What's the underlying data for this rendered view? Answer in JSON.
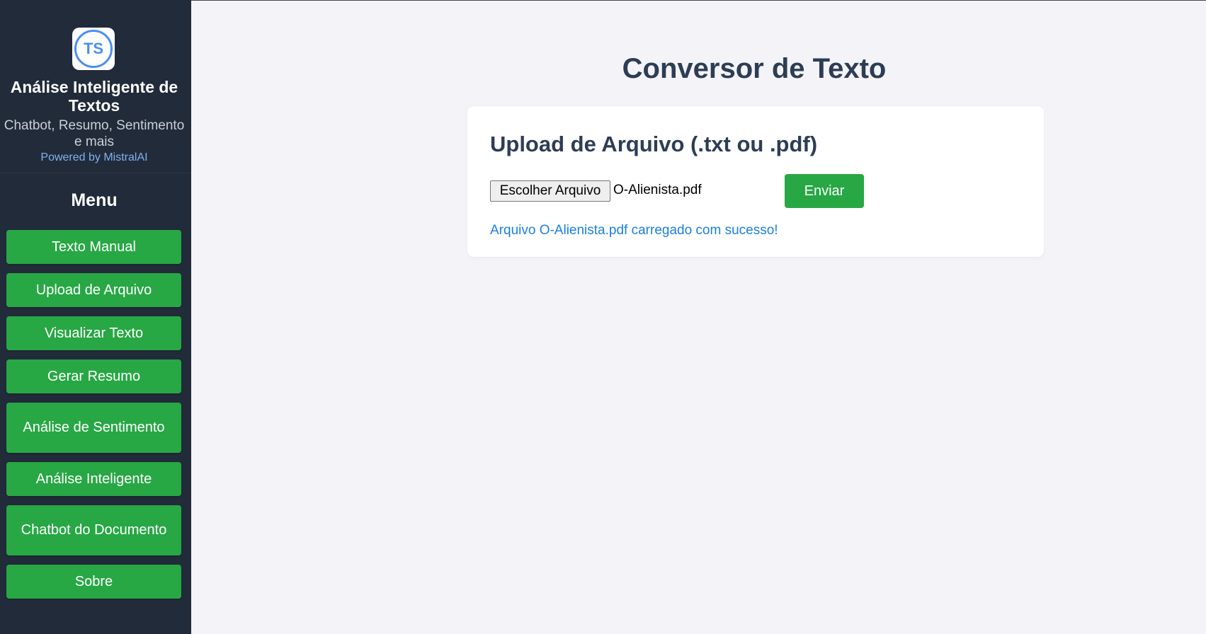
{
  "sidebar": {
    "logo_text": "TS",
    "app_title": "Análise Inteligente de Textos",
    "app_subtitle": "Chatbot, Resumo, Sentimento e mais",
    "powered_by": "Powered by MistralAI",
    "menu_title": "Menu",
    "items": [
      {
        "label": "Texto Manual"
      },
      {
        "label": "Upload de Arquivo"
      },
      {
        "label": "Visualizar Texto"
      },
      {
        "label": "Gerar Resumo"
      },
      {
        "label": "Análise de Sentimento"
      },
      {
        "label": "Análise Inteligente"
      },
      {
        "label": "Chatbot do Documento"
      },
      {
        "label": "Sobre"
      }
    ]
  },
  "main": {
    "page_title": "Conversor de Texto",
    "upload_card": {
      "title": "Upload de Arquivo (.txt ou .pdf)",
      "choose_file_label": "Escolher Arquivo",
      "selected_file": "O-Alienista.pdf",
      "submit_label": "Enviar",
      "status_message": "Arquivo O-Alienista.pdf carregado com sucesso!"
    }
  },
  "colors": {
    "sidebar_bg": "#222b39",
    "accent_green": "#28a745",
    "title_color": "#2d3d55",
    "link_blue": "#1a7fe0",
    "logo_blue": "#4a8ef0"
  }
}
